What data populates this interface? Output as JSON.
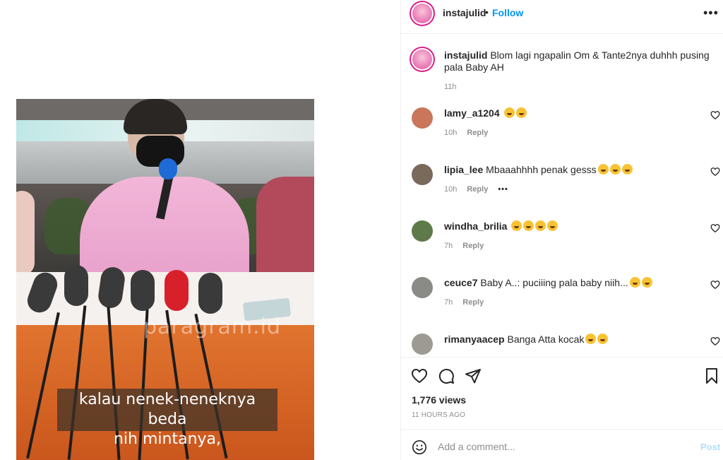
{
  "video": {
    "watermark": "paragram.id",
    "subtitle": "kalau nenek-neneknya beda\nnih mintanya,"
  },
  "header": {
    "username": "instajulid",
    "separator": "•",
    "follow_label": "Follow",
    "more_label": "•••"
  },
  "caption": {
    "username": "instajulid",
    "text": "Blom lagi ngapalin Om & Tante2nya duhhh pusing pala Baby AH",
    "time": "11h"
  },
  "comments": [
    {
      "username": "lamy_a1204",
      "text": "",
      "emoji_count": 2,
      "time": "10h",
      "reply_label": "Reply",
      "show_more": false,
      "avatar_color": "#c9765a"
    },
    {
      "username": "lipia_lee",
      "text": "Mbaaahhhh penak gesss",
      "emoji_count": 3,
      "time": "10h",
      "reply_label": "Reply",
      "show_more": true,
      "more_label": "•••",
      "avatar_color": "#7a6a5c"
    },
    {
      "username": "windha_brilia",
      "text": "",
      "emoji_count": 4,
      "time": "7h",
      "reply_label": "Reply",
      "show_more": false,
      "avatar_color": "#5f7a4a"
    },
    {
      "username": "ceuce7",
      "text": "Baby A..: puciiing pala baby niih...",
      "emoji_count": 2,
      "time": "7h",
      "reply_label": "Reply",
      "show_more": false,
      "avatar_color": "#8a8a86"
    },
    {
      "username": "rimanyaacep",
      "text": "Banga Atta kocak",
      "emoji_count": 2,
      "time": "",
      "reply_label": "",
      "show_more": false,
      "avatar_color": "#9d9a94"
    }
  ],
  "actions": {
    "like_icon": "heart-icon",
    "comment_icon": "comment-icon",
    "share_icon": "send-icon",
    "save_icon": "bookmark-icon",
    "views": "1,776 views",
    "time_ago": "11 HOURS AGO"
  },
  "add_comment": {
    "emoji_icon": "smiley-icon",
    "placeholder": "Add a comment...",
    "post_label": "Post"
  },
  "colors": {
    "follow": "#0095f6",
    "post_disabled": "#b2dffc",
    "meta": "#8e8e8e",
    "avatar_ring": "#d91c87"
  }
}
